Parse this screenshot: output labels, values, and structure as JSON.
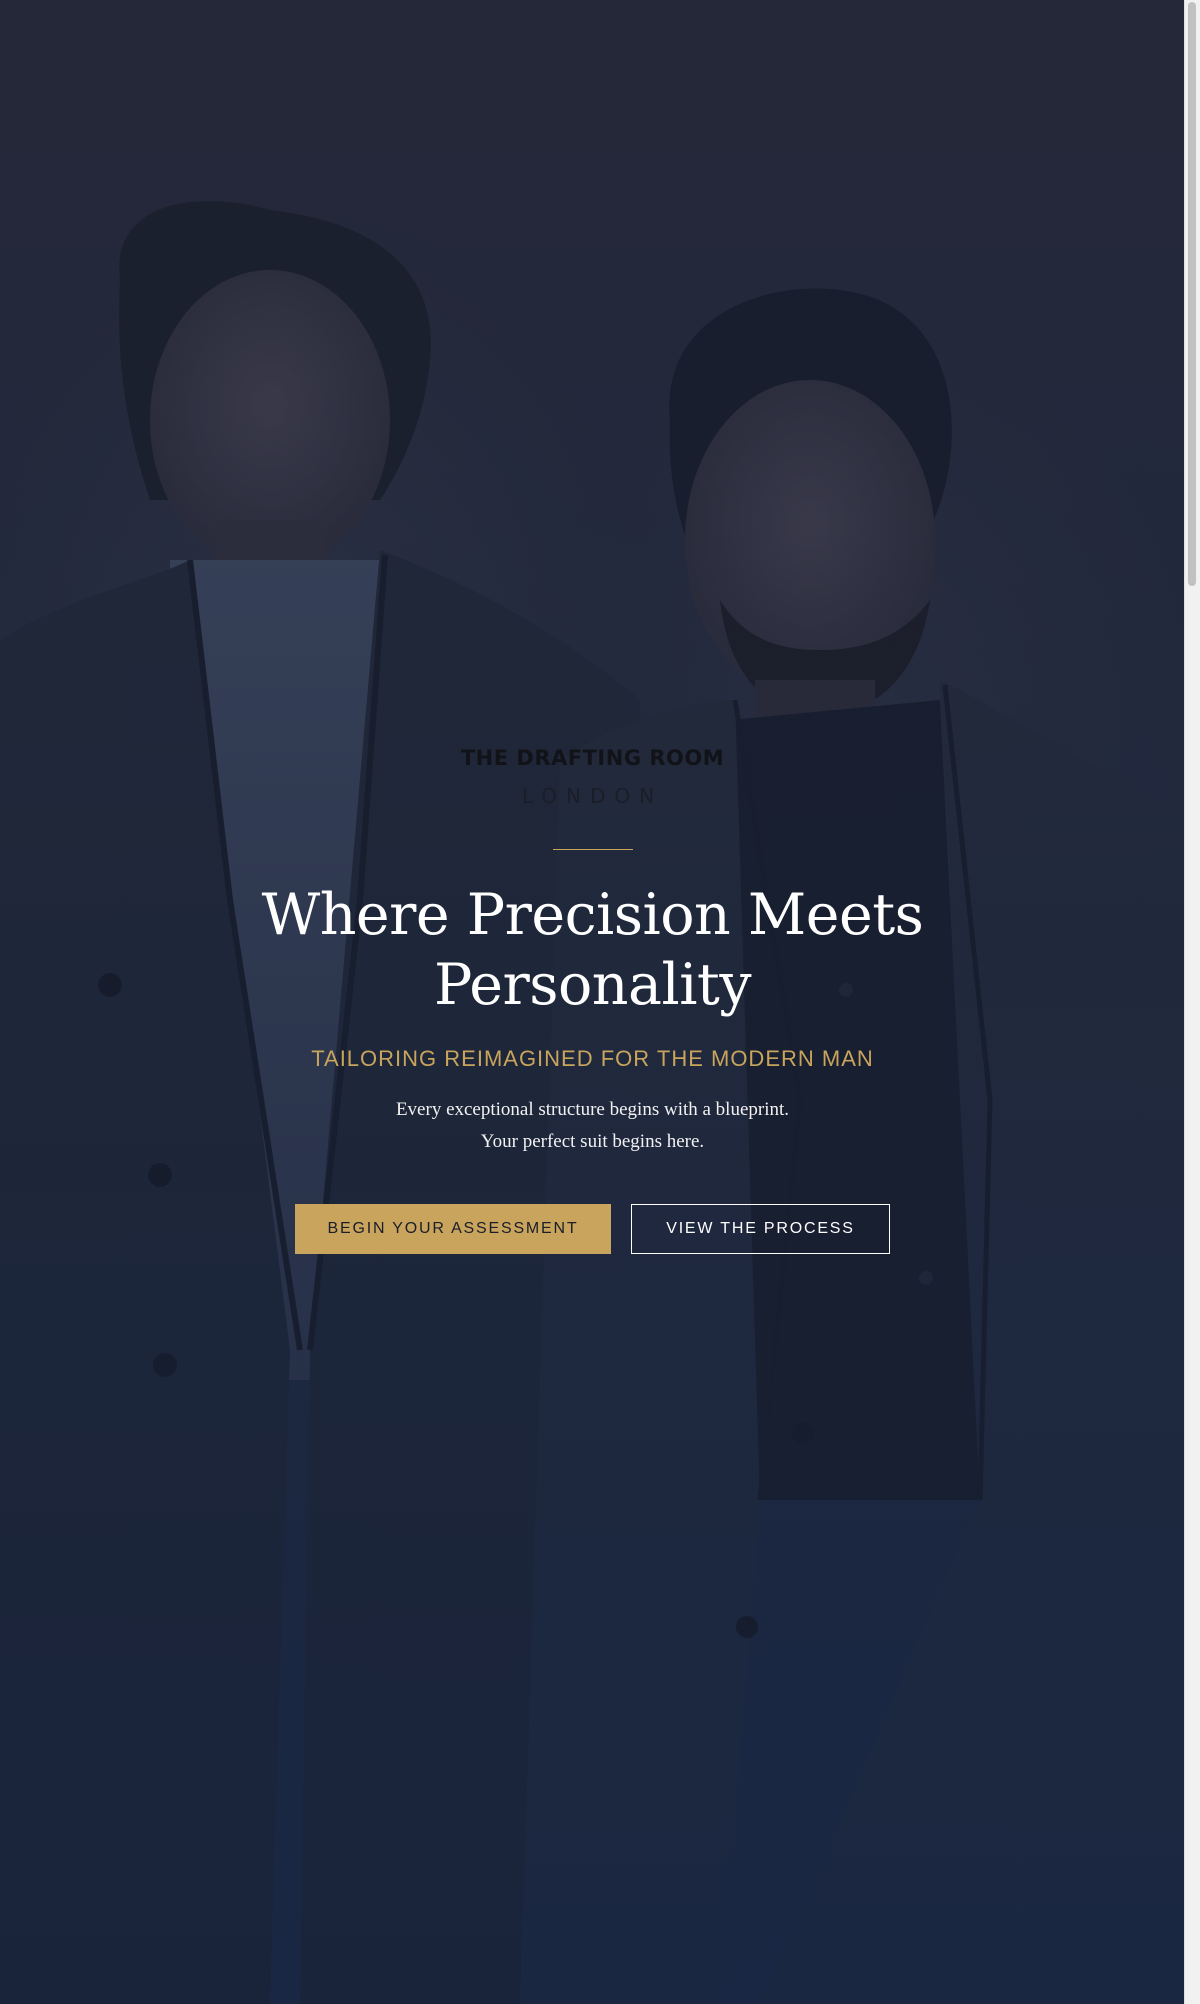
{
  "brand": {
    "name": "THE DRAFTING ROOM",
    "city": "LONDON"
  },
  "hero": {
    "image": "portrait of two men in tailored suits",
    "headline": "Where Precision Meets Personality",
    "tagline": "TAILORING REIMAGINED FOR THE MODERN MAN",
    "description_line1": "Every exceptional structure begins with a blueprint.",
    "description_line2": "Your perfect suit begins here.",
    "primary_button": "BEGIN YOUR ASSESSMENT",
    "secondary_button": "VIEW THE PROCESS"
  },
  "colors": {
    "accent_gold": "#c9a45c",
    "background_navy": "#1b2a48",
    "text_white": "#ffffff"
  }
}
